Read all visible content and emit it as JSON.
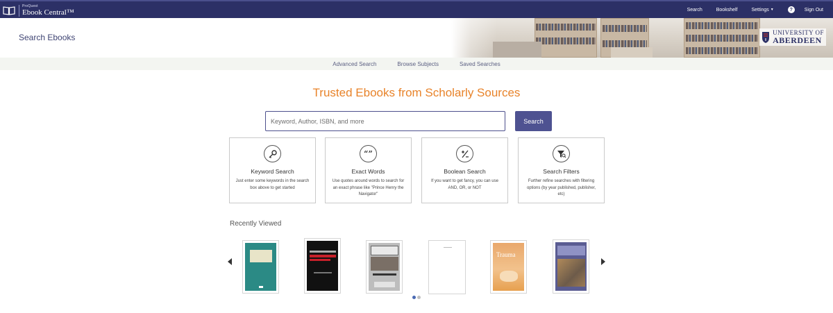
{
  "app": {
    "brand_small": "ProQuest",
    "brand_name": "Ebook Central™"
  },
  "topnav": {
    "search": "Search",
    "bookshelf": "Bookshelf",
    "settings": "Settings",
    "help": "?",
    "signout": "Sign Out"
  },
  "header": {
    "title": "Search Ebooks",
    "institution_line1": "UNIVERSITY OF",
    "institution_line2": "ABERDEEN"
  },
  "subnav": {
    "advanced": "Advanced Search",
    "browse": "Browse Subjects",
    "saved": "Saved Searches"
  },
  "hero": {
    "title": "Trusted Ebooks from Scholarly Sources",
    "search_placeholder": "Keyword, Author, ISBN, and more",
    "search_value": "",
    "search_button": "Search"
  },
  "cards": [
    {
      "icon": "key-icon",
      "title": "Keyword Search",
      "desc": "Just enter some keywords in the search box above to get started"
    },
    {
      "icon": "quote-icon",
      "title": "Exact Words",
      "desc": "Use quotes around words to search for an exact phrase like \"Prince Henry the Navigator\""
    },
    {
      "icon": "plus-minus-icon",
      "title": "Boolean Search",
      "desc": "If you want to get fancy, you can use AND, OR, or NOT"
    },
    {
      "icon": "filter-icon",
      "title": "Search Filters",
      "desc": "Further refine searches with filtering options (by year published, publisher, etc)"
    }
  ],
  "recent": {
    "title": "Recently Viewed",
    "books": [
      {
        "cover": "teal"
      },
      {
        "cover": "black-red"
      },
      {
        "cover": "grey"
      },
      {
        "cover": "white"
      },
      {
        "cover": "orange",
        "cover_text": "Trauma"
      },
      {
        "cover": "photo-blue"
      }
    ],
    "page_count": 2,
    "active_page": 1
  },
  "colors": {
    "nav_bg": "#2c3066",
    "accent": "#e8832a",
    "button": "#4e5291",
    "dot_active": "#4a6ab3",
    "dot_inactive": "#c0c0c0"
  }
}
